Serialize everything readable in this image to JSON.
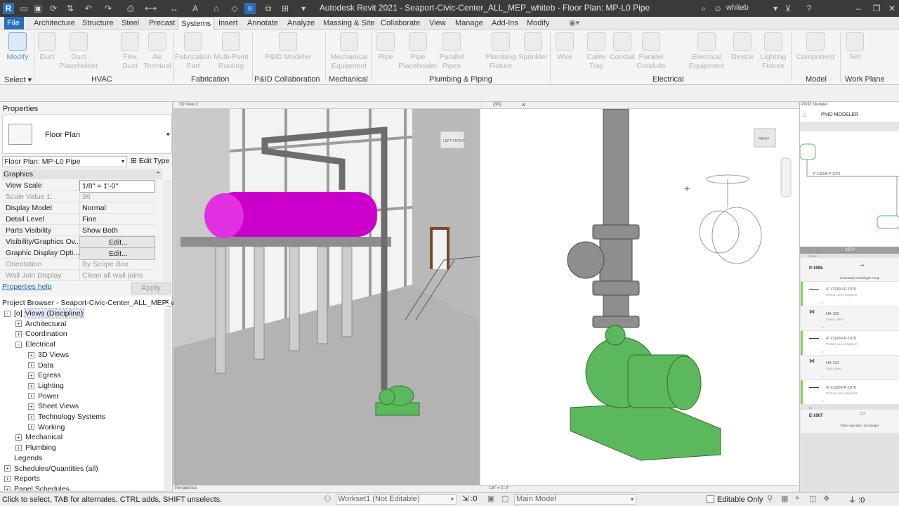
{
  "titlebar": {
    "title": "Autodesk Revit 2021 - Seaport-Civic-Center_ALL_MEP_whiteb - Floor Plan: MP-L0 Pipe",
    "user": "whiteb"
  },
  "menu": {
    "tabs": [
      "File",
      "Architecture",
      "Structure",
      "Steel",
      "Precast",
      "Systems",
      "Insert",
      "Annotate",
      "Analyze",
      "Massing & Site",
      "Collaborate",
      "View",
      "Manage",
      "Add-Ins",
      "Modify"
    ],
    "active": "Systems"
  },
  "ribbon": {
    "buttons": {
      "modify": "Modify",
      "duct": "Duct",
      "duct_placeholder": "Duct Placeholder",
      "flex_duct": "Flex Duct",
      "air_terminal": "Air Terminal",
      "fabrication_part": "Fabrication Part",
      "multipoint": "Multi-Point Routing",
      "pid_modeler": "P&ID Modeler",
      "mech_equipment": "Mechanical Equipment",
      "pipe": "Pipe",
      "pipe_placeholder": "Pipe Placeholder",
      "parallel_pipes": "Parallel Pipes",
      "plumbing_fixture": "Plumbing Fixture",
      "sprinkler": "Sprinkler",
      "wire": "Wire",
      "cable_tray": "Cable Tray",
      "conduit": "Conduit",
      "parallel_conduits": "Parallel Conduits",
      "electrical_equipment": "Electrical Equipment",
      "device": "Device",
      "lighting_fixture": "Lighting Fixture",
      "component": "Component",
      "set": "Set"
    },
    "groups": {
      "select": "Select",
      "hvac": "HVAC",
      "fabrication": "Fabrication",
      "pid": "P&ID Collaboration",
      "mechanical": "Mechanical",
      "plumbing": "Plumbing & Piping",
      "electrical": "Electrical",
      "model": "Model",
      "workplane": "Work Plane"
    }
  },
  "properties": {
    "title": "Properties",
    "type_name": "Floor Plan",
    "instance": "Floor Plan: MP-L0 Pipe",
    "edit_type": "Edit Type",
    "section": "Graphics",
    "rows": [
      {
        "k": "View Scale",
        "v": "1/8\" = 1'-0\""
      },
      {
        "k": "Scale Value    1:",
        "v": "96"
      },
      {
        "k": "Display Model",
        "v": "Normal"
      },
      {
        "k": "Detail Level",
        "v": "Fine"
      },
      {
        "k": "Parts Visibility",
        "v": "Show Both"
      },
      {
        "k": "Visibility/Graphics Ov...",
        "v": "Edit..."
      },
      {
        "k": "Graphic Display Opti...",
        "v": "Edit..."
      },
      {
        "k": "Orientation",
        "v": "By Scope Box"
      },
      {
        "k": "Wall Join Display",
        "v": "Clean all wall joins"
      }
    ],
    "help": "Properties help",
    "apply": "Apply"
  },
  "browser": {
    "title": "Project Browser - Seaport-Civic-Center_ALL_MEP_whi...",
    "items": [
      {
        "label": "Views (Discipline)",
        "level": 0,
        "sign": "-"
      },
      {
        "label": "Architectural",
        "level": 1,
        "sign": "+"
      },
      {
        "label": "Coordination",
        "level": 1,
        "sign": "+"
      },
      {
        "label": "Electrical",
        "level": 1,
        "sign": "-"
      },
      {
        "label": "3D Views",
        "level": 2,
        "sign": "+"
      },
      {
        "label": "Data",
        "level": 2,
        "sign": "+"
      },
      {
        "label": "Egress",
        "level": 2,
        "sign": "+"
      },
      {
        "label": "Lighting",
        "level": 2,
        "sign": "+"
      },
      {
        "label": "Power",
        "level": 2,
        "sign": "+"
      },
      {
        "label": "Sheet Views",
        "level": 2,
        "sign": "+"
      },
      {
        "label": "Technology Systems",
        "level": 2,
        "sign": "+"
      },
      {
        "label": "Working",
        "level": 2,
        "sign": "+"
      },
      {
        "label": "Mechanical",
        "level": 1,
        "sign": "+"
      },
      {
        "label": "Plumbing",
        "level": 1,
        "sign": "+"
      },
      {
        "label": "Legends",
        "level": 0,
        "sign": ""
      },
      {
        "label": "Schedules/Quantities (all)",
        "level": 0,
        "sign": "+"
      },
      {
        "label": "Reports",
        "level": 0,
        "sign": "+"
      },
      {
        "label": "Panel Schedules",
        "level": 0,
        "sign": "+"
      }
    ]
  },
  "views": {
    "left_tab": "3D View 2",
    "right_tab": "{3D}",
    "left_bottom": "Perspective",
    "right_bottom": "1/8\" = 1'-0\"",
    "viewcube_left": "LEFT  FRONT",
    "viewcube_right": "RIGHT"
  },
  "pnid": {
    "panel_title": "PNID Modeler",
    "header": "PNID MODELER",
    "diagram_label": "4\"-CS300-P-1070",
    "line_header": "1070",
    "from_label": "FROM",
    "to_label": "TO",
    "cards": [
      {
        "tag": "P-1005",
        "desc": "Horizontal Centrifugal Pump",
        "kind": "equip"
      },
      {
        "tag": "4\"-CS300-P-1070",
        "desc": "Primary Line Segment",
        "kind": "seg",
        "size": "4\""
      },
      {
        "tag": "HA-102",
        "desc": "Check Valve",
        "kind": "valve",
        "size": "4\""
      },
      {
        "tag": "4\"-CS300-P-1070",
        "desc": "Primary Line Segment",
        "kind": "seg",
        "size": "4\""
      },
      {
        "tag": "HA-101",
        "desc": "Gate Valve",
        "kind": "valve",
        "size": "4\""
      },
      {
        "tag": "4\"-CS300-P-1070",
        "desc": "Primary Line Segment",
        "kind": "seg",
        "size": "4\""
      },
      {
        "tag": "E-1007",
        "desc": "TEMA type BEU Exchanger",
        "kind": "equip"
      }
    ]
  },
  "status": {
    "hint": "Click to select, TAB for alternates, CTRL adds, SHIFT unselects.",
    "workset": "Workset1 (Not Editable)",
    "zero1": ":0",
    "model": "Main Model",
    "editable_only": "Editable Only",
    "zero2": ":0"
  },
  "colors": {
    "accent": "#2a6ebb",
    "vessel": "#cc00cc",
    "pump": "#5cb85c",
    "pipe": "#8a8a8a"
  }
}
